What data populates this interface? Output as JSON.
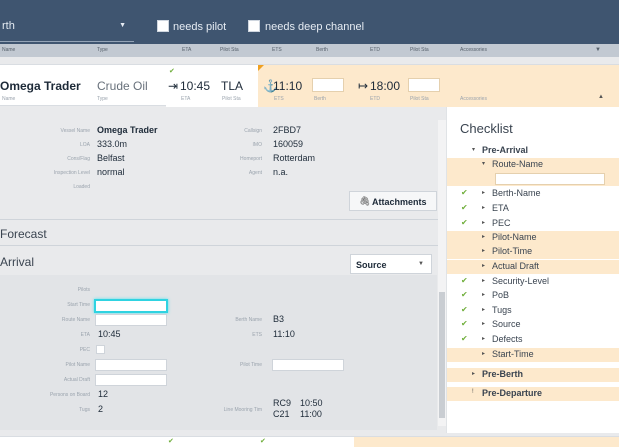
{
  "filters": {
    "berth_label": "rth",
    "needs_pilot": "needs pilot",
    "needs_deep_channel": "needs deep channel"
  },
  "columns": [
    "Name",
    "Type",
    "ETA",
    "Pilot Sta",
    "ETS",
    "Berth",
    "ETD",
    "Pilot Sta",
    "Accessories"
  ],
  "vessel": {
    "name": "Omega Trader",
    "name_sub": "Name",
    "type": "Crude Oil",
    "type_sub": "Type",
    "eta": "10:45",
    "eta_sub": "ETA",
    "pilot": "TLA",
    "pilot_sub": "Pilot Sta",
    "ets": "11:10",
    "ets_sub": "ETS",
    "berth_sub": "Berth",
    "etd": "18:00",
    "etd_sub": "ETD",
    "etd_pilot_sub": "Pilot Sta",
    "access_sub": "Accessories"
  },
  "details": {
    "labels": [
      "Vessel Name",
      "LOA",
      "Cons/Flag",
      "Inspection Level",
      "Loaded"
    ],
    "values": [
      "Omega Trader",
      "333.0m",
      "Belfast",
      "normal",
      ""
    ],
    "labels2": [
      "Callsign",
      "IMO",
      "Homeport",
      "Agent"
    ],
    "values2": [
      "2FBD7",
      "160059",
      "Rotterdam",
      "n.a."
    ],
    "attachments": "Attachments"
  },
  "forecast_title": "Forecast",
  "arrival": {
    "title": "Arrival",
    "source": "Source",
    "labels": [
      "Pilots",
      "Start Time",
      "Route Name",
      "ETA",
      "PEC",
      "Pilot Name",
      "Actual Draft",
      "Persons on Board",
      "Tugs"
    ],
    "eta": "10:45",
    "pob": "12",
    "tugs": "2",
    "berth_name_label": "Berth Name",
    "berth_name": "B3",
    "ets_label": "ETS",
    "ets": "11:10",
    "pilot_time_label": "Pilot Time",
    "line_moorings_label": "Line Mooring Tim",
    "mooring": [
      "RC9",
      "10:50",
      "C21",
      "11:00"
    ]
  },
  "checklist": {
    "title": "Checklist",
    "items": [
      {
        "label": "Pre-Arrival",
        "bold": true,
        "arrow": "▾",
        "indent": 1
      },
      {
        "label": "Route-Name",
        "arrow": "▾",
        "indent": 2,
        "hl": true
      },
      {
        "label": "Berth-Name",
        "arrow": "▸",
        "indent": 2,
        "check": true
      },
      {
        "label": "ETA",
        "arrow": "▸",
        "indent": 2,
        "check": true
      },
      {
        "label": "PEC",
        "arrow": "▸",
        "indent": 2,
        "check": true
      },
      {
        "label": "Pilot-Name",
        "arrow": "▸",
        "indent": 2,
        "hl": true
      },
      {
        "label": "Pilot-Time",
        "arrow": "▸",
        "indent": 2,
        "hl": true
      },
      {
        "label": "Actual Draft",
        "arrow": "▸",
        "indent": 2,
        "hl": true
      },
      {
        "label": "Security-Level",
        "arrow": "▸",
        "indent": 2,
        "check": true
      },
      {
        "label": "PoB",
        "arrow": "▸",
        "indent": 2,
        "check": true
      },
      {
        "label": "Tugs",
        "arrow": "▸",
        "indent": 2,
        "check": true
      },
      {
        "label": "Source",
        "arrow": "▸",
        "indent": 2,
        "check": true
      },
      {
        "label": "Defects",
        "arrow": "▸",
        "indent": 2,
        "check": true
      },
      {
        "label": "Start-Time",
        "arrow": "▸",
        "indent": 2,
        "hl": true
      },
      {
        "label": "Pre-Berth",
        "bold": true,
        "arrow": "▸",
        "indent": 1,
        "hl": true
      },
      {
        "label": "Pre-Departure",
        "bold": true,
        "arrow": "!",
        "indent": 1,
        "hl": true
      }
    ]
  },
  "colors": {
    "topbar": "#3f5570",
    "highlight": "#fde9cc",
    "focus": "#2fd3e1",
    "check": "#6fae3b"
  }
}
